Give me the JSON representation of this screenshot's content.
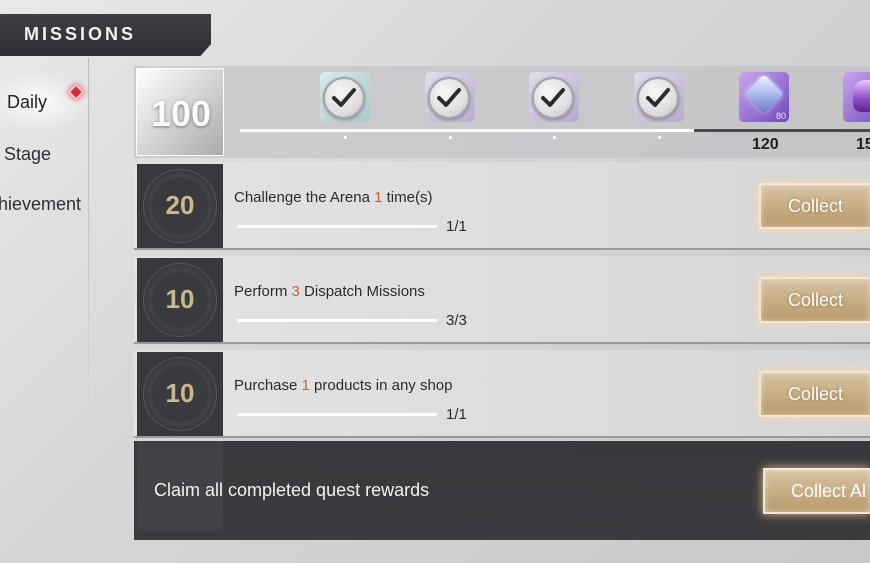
{
  "header": {
    "title": "MISSIONS"
  },
  "sidebar": {
    "items": [
      {
        "label": "Daily",
        "active": true
      },
      {
        "label": "Stage",
        "active": false
      },
      {
        "label": "hievement",
        "active": false
      }
    ]
  },
  "points": {
    "current": "100",
    "progress_fraction": 0.72,
    "rewards": [
      {
        "icon": "check-icon",
        "claimed": true
      },
      {
        "icon": "check-icon",
        "claimed": true
      },
      {
        "icon": "check-icon",
        "claimed": true
      },
      {
        "icon": "check-icon",
        "claimed": true
      },
      {
        "icon": "crystal-icon",
        "claimed": false,
        "qty": "80"
      },
      {
        "icon": "crystal-icon",
        "claimed": false
      }
    ],
    "milestones": [
      "120",
      "15"
    ]
  },
  "missions": [
    {
      "points": "20",
      "text_before": "Challenge the Arena ",
      "highlight": "1",
      "text_after": " time(s)",
      "progress": "1/1",
      "progress_fraction": 1.0,
      "button": "Collect"
    },
    {
      "points": "10",
      "text_before": "Perform ",
      "highlight": "3",
      "text_after": " Dispatch Missions",
      "progress": "3/3",
      "progress_fraction": 1.0,
      "button": "Collect"
    },
    {
      "points": "10",
      "text_before": "Purchase ",
      "highlight": "1",
      "text_after": " products in any shop",
      "progress": "1/1",
      "progress_fraction": 1.0,
      "button": "Collect"
    }
  ],
  "claim_all": {
    "text": "Claim all completed quest rewards",
    "button": "Collect Al"
  },
  "colors": {
    "highlight": "#c2662e",
    "badge_text": "#c9b98c",
    "button_gold": "#c7ab82",
    "notification": "#d8283a"
  }
}
